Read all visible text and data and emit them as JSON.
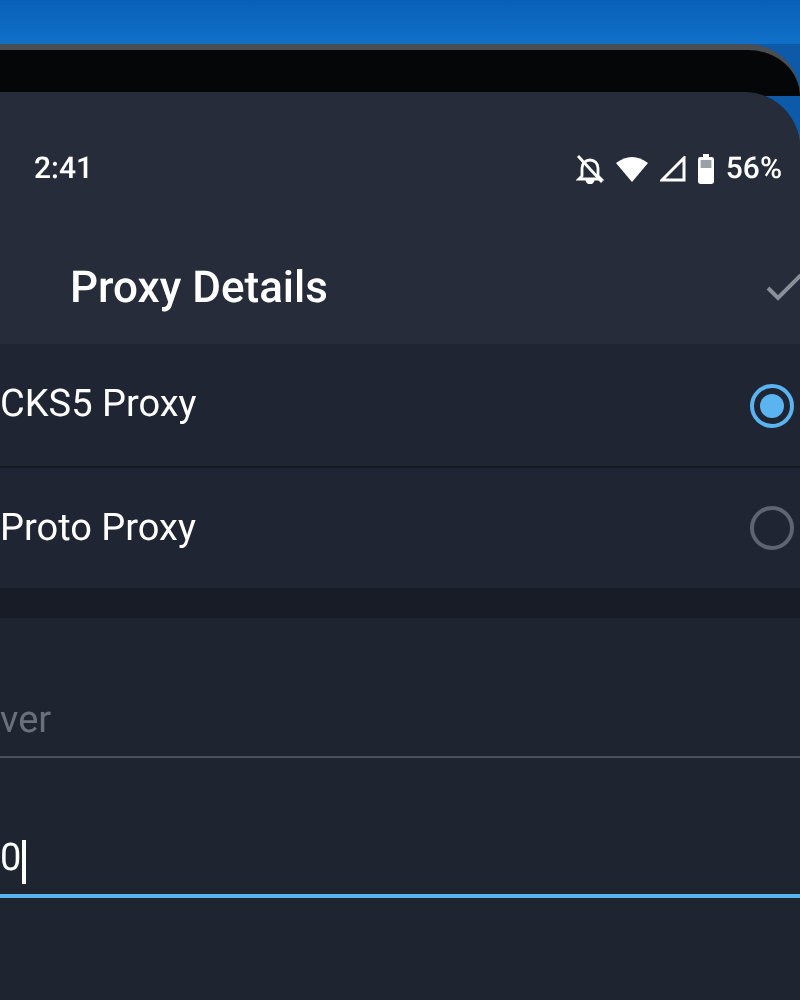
{
  "status_bar": {
    "time": "2:41",
    "battery": "56%"
  },
  "header": {
    "title": "Proxy Details"
  },
  "proxy_types": [
    {
      "label": "CKS5 Proxy",
      "selected": true
    },
    {
      "label": "Proto Proxy",
      "selected": false
    }
  ],
  "fields": [
    {
      "placeholder": "ver",
      "focused": false
    },
    {
      "value": "0",
      "focused": true
    }
  ]
}
